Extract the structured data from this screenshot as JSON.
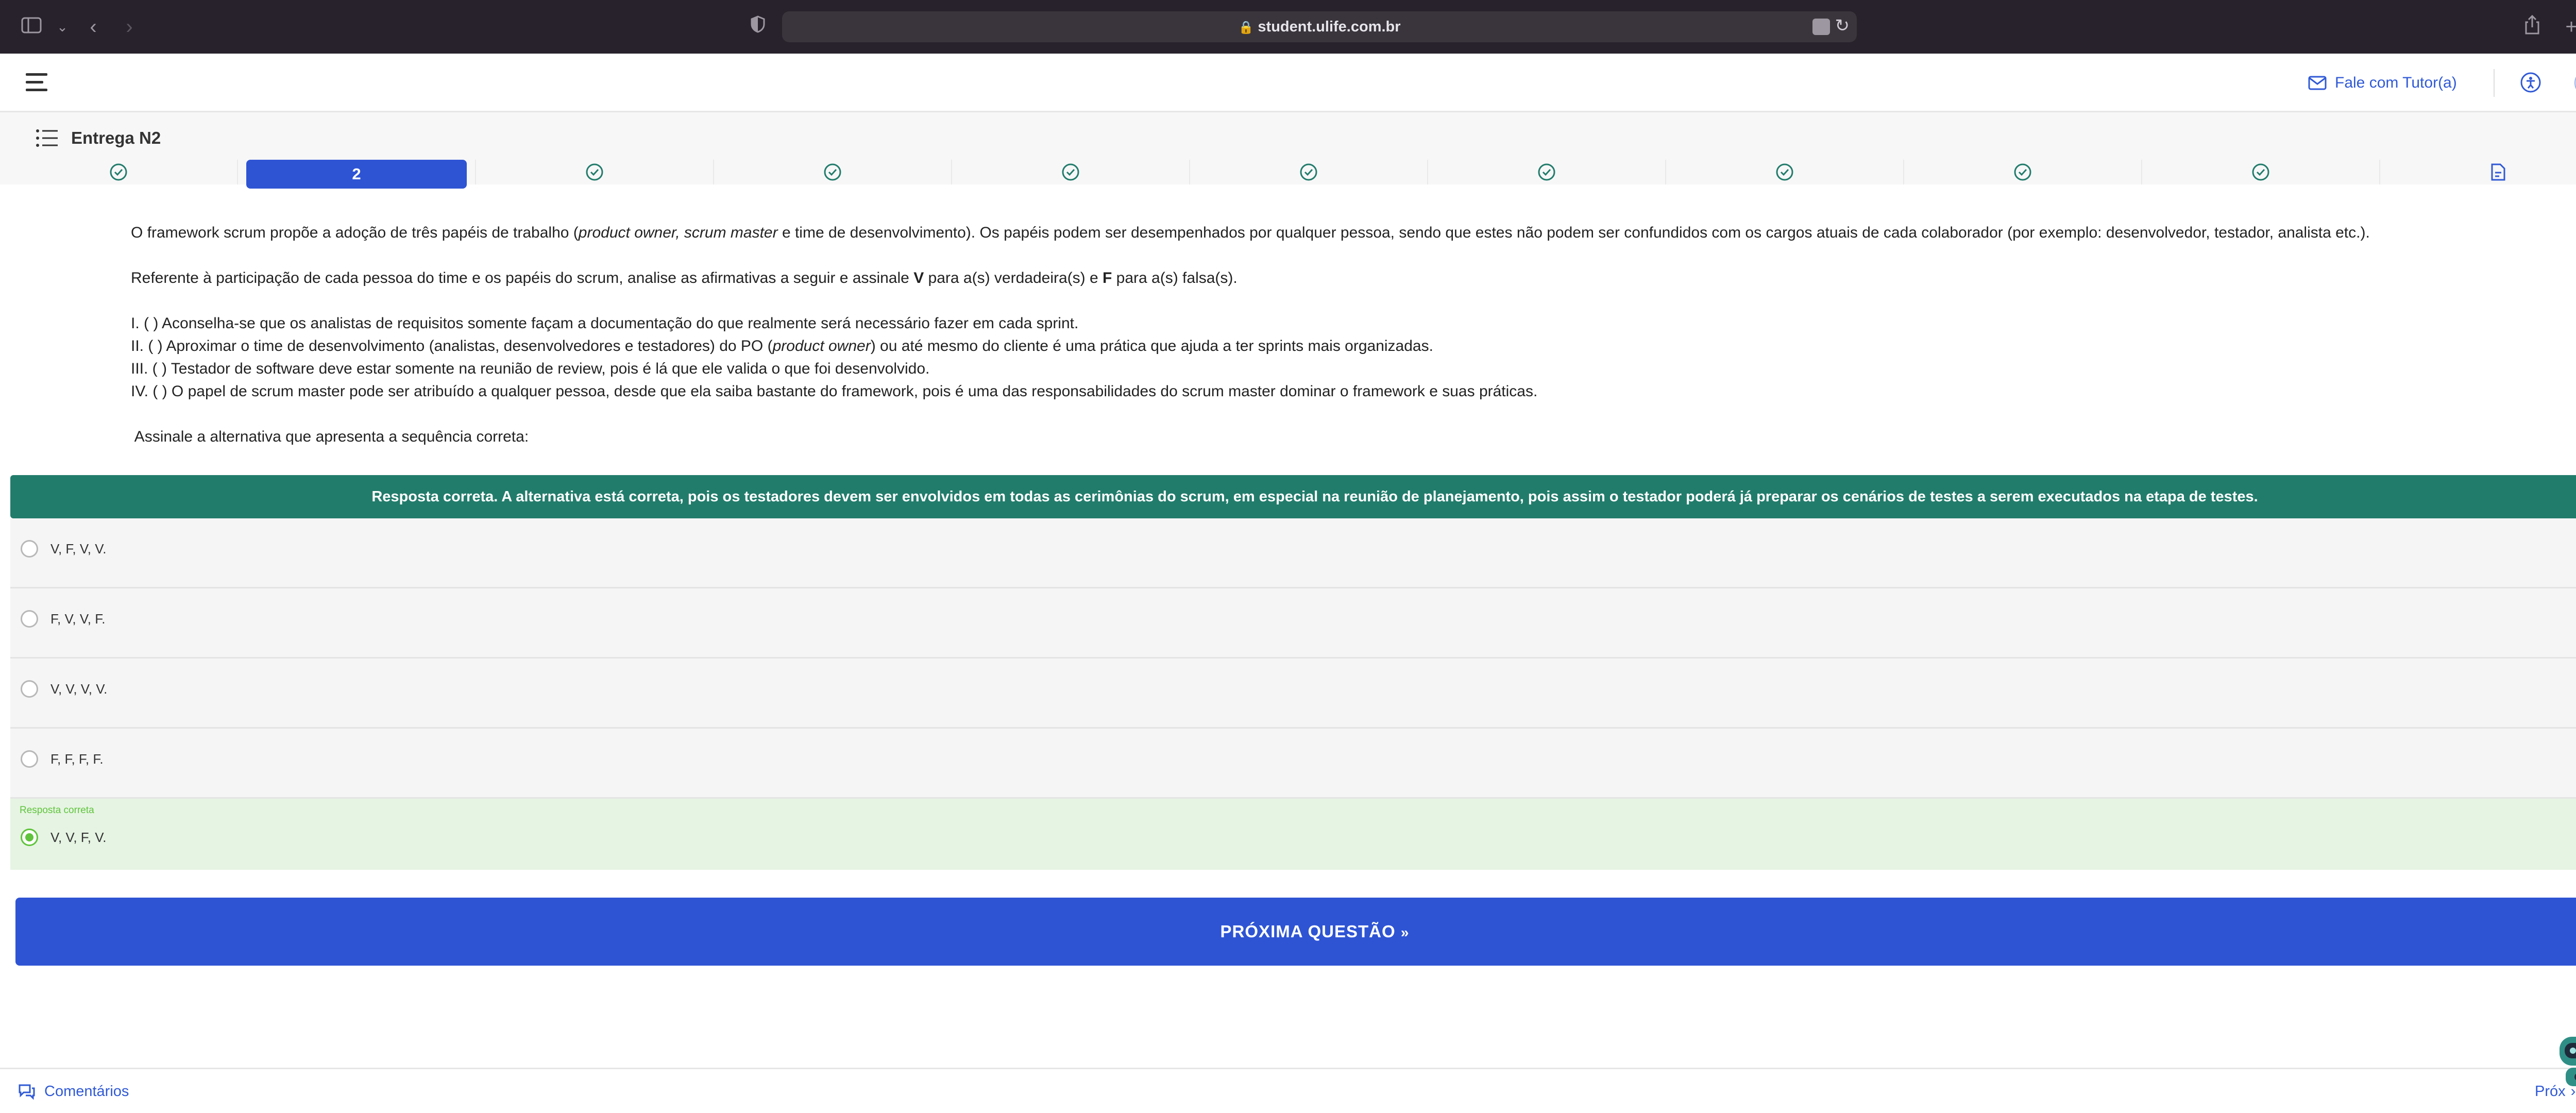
{
  "browser": {
    "url": "student.ulife.com.br"
  },
  "header": {
    "tutor_link": "Fale com Tutor(a)"
  },
  "title_row": {
    "title": "Entrega N2",
    "steps": [
      {
        "label": "",
        "status": "done"
      },
      {
        "label": "2",
        "status": "active"
      },
      {
        "label": "",
        "status": "done"
      },
      {
        "label": "",
        "status": "done"
      },
      {
        "label": "",
        "status": "done"
      },
      {
        "label": "",
        "status": "done"
      },
      {
        "label": "",
        "status": "done"
      },
      {
        "label": "",
        "status": "done"
      },
      {
        "label": "",
        "status": "done"
      },
      {
        "label": "",
        "status": "done"
      },
      {
        "label": "",
        "status": "delivery"
      }
    ]
  },
  "question": {
    "p1_a": "O framework scrum propõe a adoção de três papéis de trabalho (",
    "p1_em": "product owner, scrum master",
    "p1_b": " e time de desenvolvimento). Os papéis podem ser desempenhados por qualquer pessoa, sendo que estes não podem ser confundidos com os cargos atuais de cada colaborador (por exemplo: desenvolvedor, testador, analista etc.).",
    "p2_a": "Referente à participação de cada pessoa do time e os papéis do scrum, analise as afirmativas a seguir e assinale ",
    "p2_v": "V",
    "p2_b": " para a(s) verdadeira(s) e ",
    "p2_f": "F",
    "p2_c": " para a(s) falsa(s).",
    "item1": "I. ( )  Aconselha-se que os analistas de requisitos somente façam a documentação do que realmente será necessário fazer em cada sprint.",
    "item2_a": "II. ( ) Aproximar o time de desenvolvimento (analistas, desenvolvedores e testadores) do PO (",
    "item2_em": "product owner",
    "item2_b": ") ou até mesmo do cliente é uma prática que ajuda a ter sprints mais organizadas.",
    "item3": "III. ( ) Testador de software deve estar somente na reunião de review, pois é lá que ele valida o que foi desenvolvido.",
    "item4": "IV. ( ) O papel de scrum master pode ser atribuído a qualquer pessoa, desde que ela saiba bastante do framework, pois é uma das responsabilidades do scrum master dominar o framework e suas práticas.",
    "prompt": " Assinale a alternativa que apresenta a sequência correta:"
  },
  "feedback": "Resposta correta. A alternativa está correta, pois os testadores devem ser envolvidos em todas as cerimônias do scrum, em especial na reunião de planejamento, pois assim o testador poderá já preparar os cenários de testes a serem executados na etapa de testes.",
  "options": [
    {
      "label": "V, F, V, V."
    },
    {
      "label": "F, V, V, F."
    },
    {
      "label": "V, V, V, V."
    },
    {
      "label": "F, F, F, F."
    },
    {
      "label": "V, V, F, V.",
      "tag": "Resposta correta"
    }
  ],
  "next_button": "PRÓXIMA QUESTÃO",
  "footer": {
    "comments": "Comentários",
    "next": "Próx"
  },
  "colors": {
    "primary": "#2e54d4",
    "feedback_bg": "#227c6b",
    "correct_green": "#5fc43c",
    "correct_bg": "#e6f4e3",
    "browser_bg": "#27222b"
  }
}
